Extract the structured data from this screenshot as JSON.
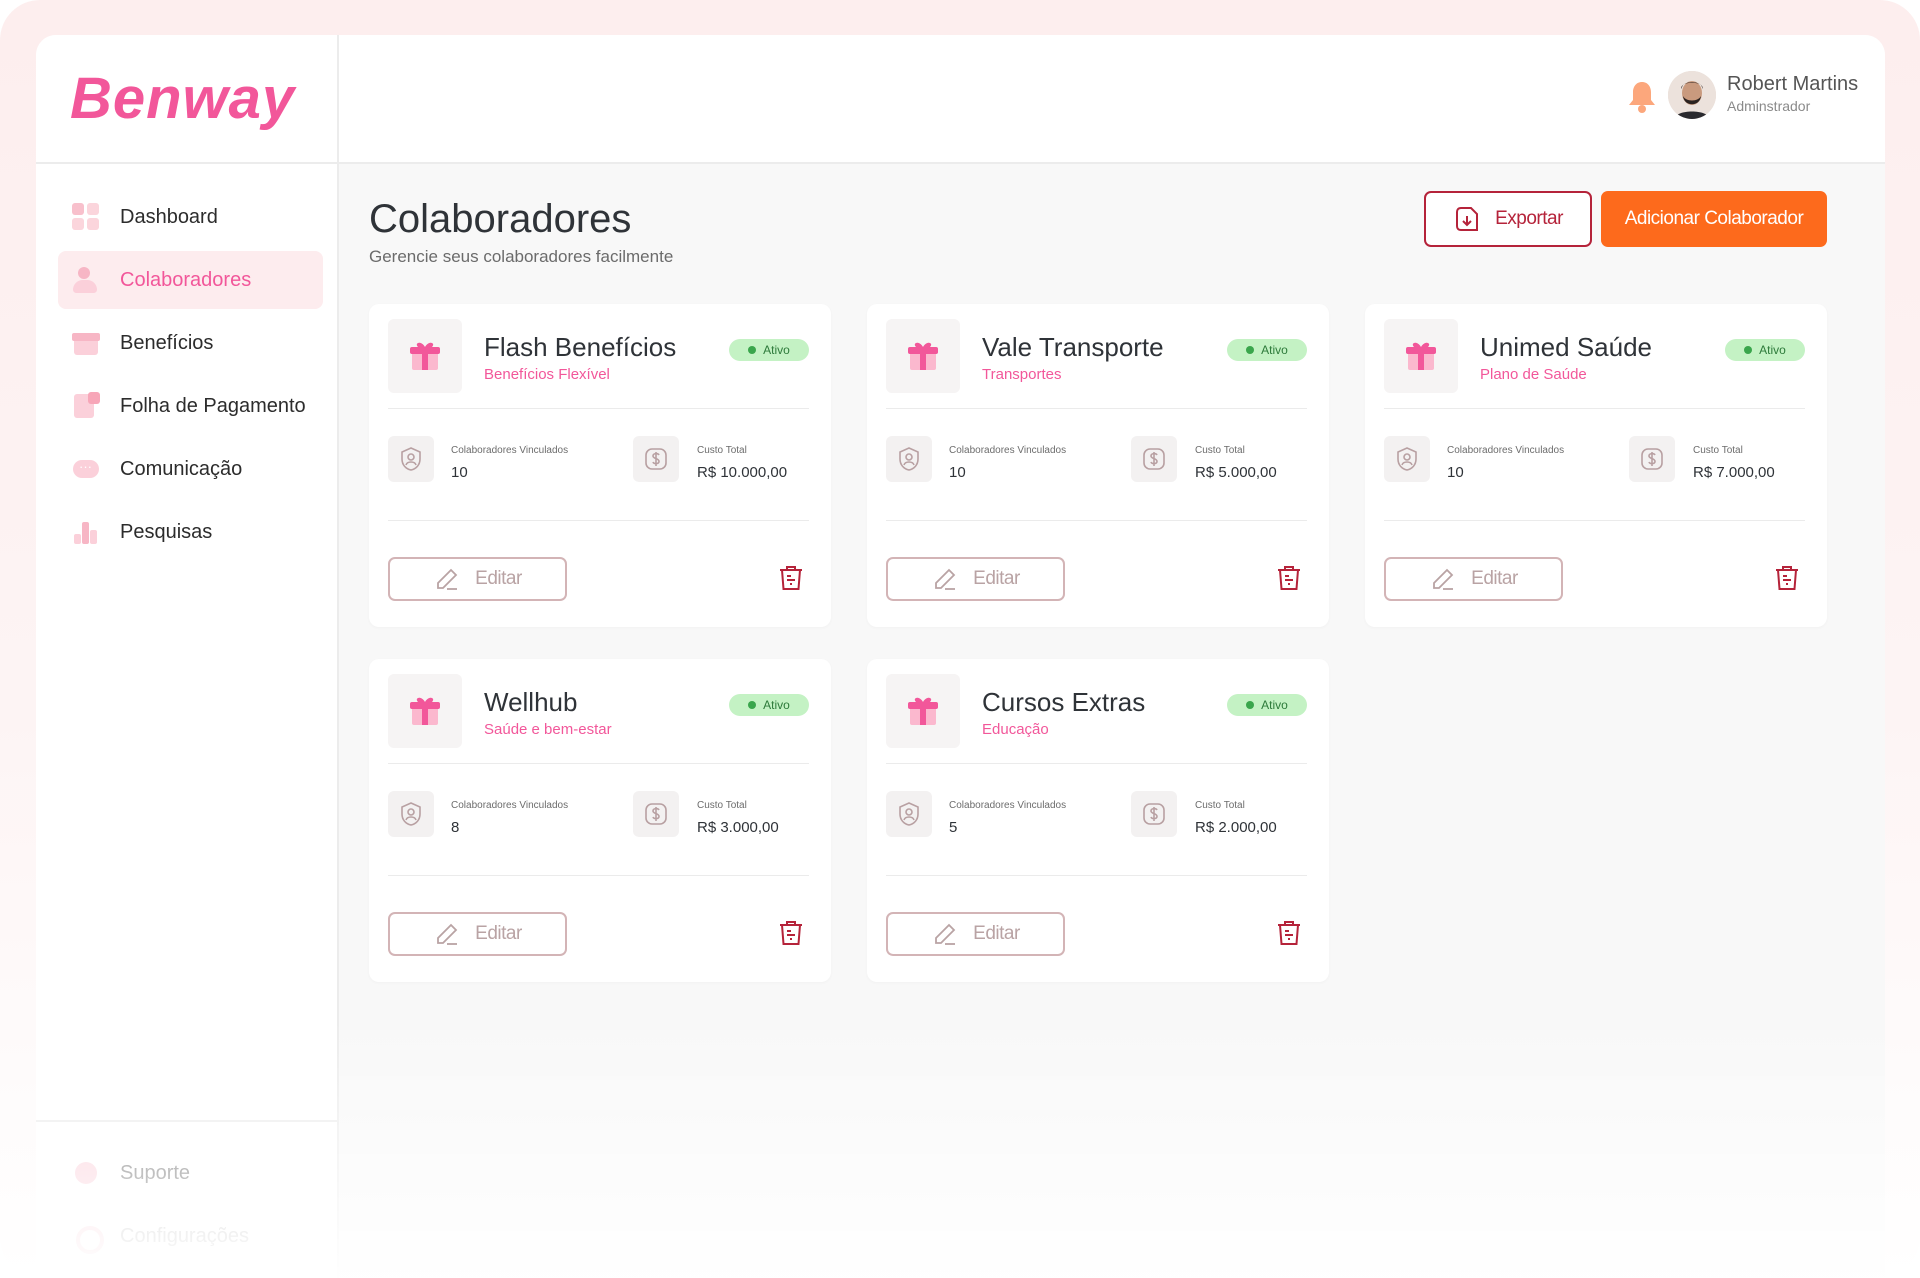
{
  "brand": {
    "logo_text": "Benway",
    "color": "#f2579a"
  },
  "sidebar": {
    "items": [
      {
        "label": "Dashboard",
        "icon": "dashboard-icon",
        "active": false
      },
      {
        "label": "Colaboradores",
        "icon": "users-icon",
        "active": true
      },
      {
        "label": "Benefícios",
        "icon": "gift-icon",
        "active": false
      },
      {
        "label": "Folha de Pagamento",
        "icon": "payroll-icon",
        "active": false
      },
      {
        "label": "Comunicação",
        "icon": "chat-icon",
        "active": false
      },
      {
        "label": "Pesquisas",
        "icon": "poll-icon",
        "active": false
      }
    ],
    "bottom_items": [
      {
        "label": "Suporte",
        "icon": "help-icon"
      },
      {
        "label": "Configurações",
        "icon": "gear-icon"
      }
    ]
  },
  "header": {
    "user_name": "Robert Martins",
    "user_role": "Adminstrador",
    "bell_icon": "bell-icon"
  },
  "page": {
    "title": "Colaboradores",
    "subtitle": "Gerencie seus colaboradores facilmente",
    "export_label": "Exportar",
    "add_label": "Adicionar Colaborador"
  },
  "colors": {
    "accent_pink": "#f2579a",
    "primary_orange": "#fd6a1c",
    "export_red": "#b5233a",
    "status_green": "#c4f2c4",
    "delete_red": "#b5233a"
  },
  "card_labels": {
    "linked": "Colaboradores Vinculados",
    "cost": "Custo Total",
    "edit": "Editar"
  },
  "benefits": [
    {
      "name": "Flash Benefícios",
      "category": "Benefícios Flexível",
      "status": "Ativo",
      "linked": "10",
      "cost": "R$ 10.000,00"
    },
    {
      "name": "Vale Transporte",
      "category": "Transportes",
      "status": "Ativo",
      "linked": "10",
      "cost": "R$ 5.000,00"
    },
    {
      "name": "Unimed Saúde",
      "category": "Plano de Saúde",
      "status": "Ativo",
      "linked": "10",
      "cost": "R$ 7.000,00"
    },
    {
      "name": "Wellhub",
      "category": "Saúde e bem-estar",
      "status": "Ativo",
      "linked": "8",
      "cost": "R$ 3.000,00"
    },
    {
      "name": "Cursos Extras",
      "category": "Educação",
      "status": "Ativo",
      "linked": "5",
      "cost": "R$ 2.000,00"
    }
  ]
}
